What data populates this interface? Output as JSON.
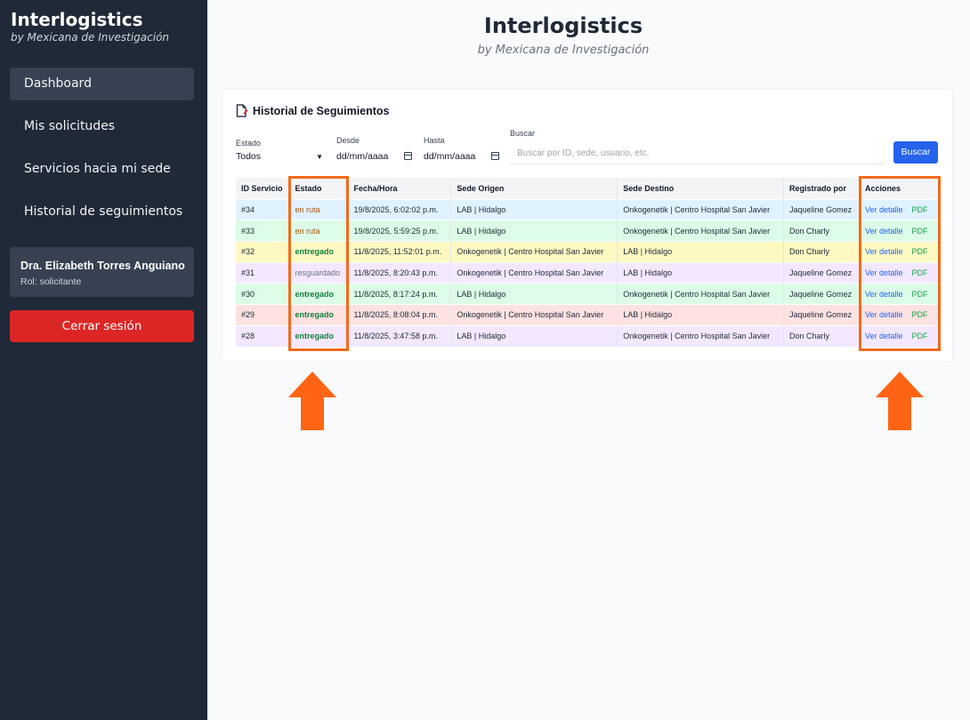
{
  "brand": {
    "title": "Interlogistics",
    "subtitle": "by Mexicana de Investigación"
  },
  "sidebar": {
    "items": [
      {
        "label": "Dashboard",
        "active": true
      },
      {
        "label": "Mis solicitudes",
        "active": false
      },
      {
        "label": "Servicios hacia mi sede",
        "active": false
      },
      {
        "label": "Historial de seguimientos",
        "active": false
      }
    ],
    "user": {
      "name": "Dra. Elizabeth Torres Anguiano",
      "role": "Rol: solicitante"
    },
    "logout_label": "Cerrar sesión"
  },
  "header": {
    "title": "Interlogistics",
    "subtitle": "by Mexicana de Investigación"
  },
  "card": {
    "title": "Historial de Seguimientos",
    "filters": {
      "estado_label": "Estado",
      "estado_value": "Todos",
      "desde_label": "Desde",
      "desde_value": "dd/mm/aaaa",
      "hasta_label": "Hasta",
      "hasta_value": "dd/mm/aaaa",
      "buscar_label": "Buscar",
      "buscar_placeholder": "Buscar por ID, sede, usuario, etc.",
      "buscar_button": "Buscar"
    },
    "table": {
      "headers": [
        "ID Servicio",
        "Estado",
        "Fecha/Hora",
        "Sede Origen",
        "Sede Destino",
        "Registrado por",
        "Acciones"
      ],
      "action_view": "Ver detalle",
      "action_pdf": "PDF",
      "rows": [
        {
          "id": "#34",
          "estado": "en ruta",
          "fecha": "19/8/2025, 6:02:02 p.m.",
          "origen": "LAB | Hidalgo",
          "destino": "Onkogenetik | Centro Hospital San Javier",
          "registrado": "Jaqueline Gomez",
          "bg": "#e0f2fe"
        },
        {
          "id": "#33",
          "estado": "en ruta",
          "fecha": "19/8/2025, 5:59:25 p.m.",
          "origen": "LAB | Hidalgo",
          "destino": "Onkogenetik | Centro Hospital San Javier",
          "registrado": "Don Charly",
          "bg": "#dcfce7"
        },
        {
          "id": "#32",
          "estado": "entregado",
          "fecha": "11/8/2025, 11:52:01 p.m.",
          "origen": "Onkogenetik | Centro Hospital San Javier",
          "destino": "LAB | Hidalgo",
          "registrado": "Don Charly",
          "bg": "#fef9c3"
        },
        {
          "id": "#31",
          "estado": "resguardado",
          "fecha": "11/8/2025, 8:20:43 p.m.",
          "origen": "Onkogenetik | Centro Hospital San Javier",
          "destino": "LAB | Hidalgo",
          "registrado": "Jaqueline Gomez",
          "bg": "#f3e8ff"
        },
        {
          "id": "#30",
          "estado": "entregado",
          "fecha": "11/8/2025, 8:17:24 p.m.",
          "origen": "LAB | Hidalgo",
          "destino": "Onkogenetik | Centro Hospital San Javier",
          "registrado": "Jaqueline Gomez",
          "bg": "#dcfce7"
        },
        {
          "id": "#29",
          "estado": "entregado",
          "fecha": "11/8/2025, 8:08:04 p.m.",
          "origen": "Onkogenetik | Centro Hospital San Javier",
          "destino": "LAB | Hidalgo",
          "registrado": "Jaqueline Gomez",
          "bg": "#fee2e2"
        },
        {
          "id": "#28",
          "estado": "entregado",
          "fecha": "11/8/2025, 3:47:58 p.m.",
          "origen": "LAB | Hidalgo",
          "destino": "Onkogenetik | Centro Hospital San Javier",
          "registrado": "Don Charly",
          "bg": "#f3e8ff"
        }
      ]
    }
  },
  "colors": {
    "sidebar": "#1f2937",
    "accent": "#2563eb",
    "logout": "#dc2626",
    "highlight": "#f26a1b"
  },
  "icons": {
    "card_title": "document-icon",
    "calendar": "calendar-icon",
    "select": "chevron-down-icon",
    "annotation": "arrow-up-icon"
  }
}
